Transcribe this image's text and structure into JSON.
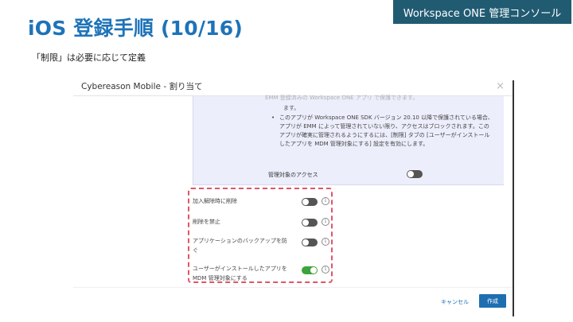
{
  "slide": {
    "title": "iOS 登録手順 (10/16)",
    "badge": "Workspace ONE 管理コンソール",
    "note": "「制限」は必要に応じて定義"
  },
  "dialog": {
    "title": "Cybereason Mobile - 割り当て",
    "close_icon": "×",
    "info_panel": {
      "fragment_top": "EMM 登録済みの Workspace ONE アプリ で保護できます。",
      "fragment_end": "ます。",
      "bullet": "このアプリが Workspace ONE SDK バージョン 20.10 以降で保護されている場合、アプリが EMM によって管理されていない限り、アクセスはブロックされます。このアプリが確実に管理されるようにするには、[制限] タブの [ユーザーがインストールしたアプリを MDM 管理対象にする] 設定を有効にします。",
      "managed_access_label": "管理対象のアクセス",
      "managed_access_on": false
    },
    "settings": [
      {
        "label": "加入解除時に削除",
        "on": false
      },
      {
        "label": "削除を禁止",
        "on": false
      },
      {
        "label": "アプリケーションのバックアップを防ぐ",
        "on": false
      },
      {
        "label": "ユーザーがインストールしたアプリを MDM 管理対象にする",
        "on": true
      }
    ],
    "info_icon": "i",
    "cancel_label": "キャンセル",
    "create_label": "作成"
  }
}
